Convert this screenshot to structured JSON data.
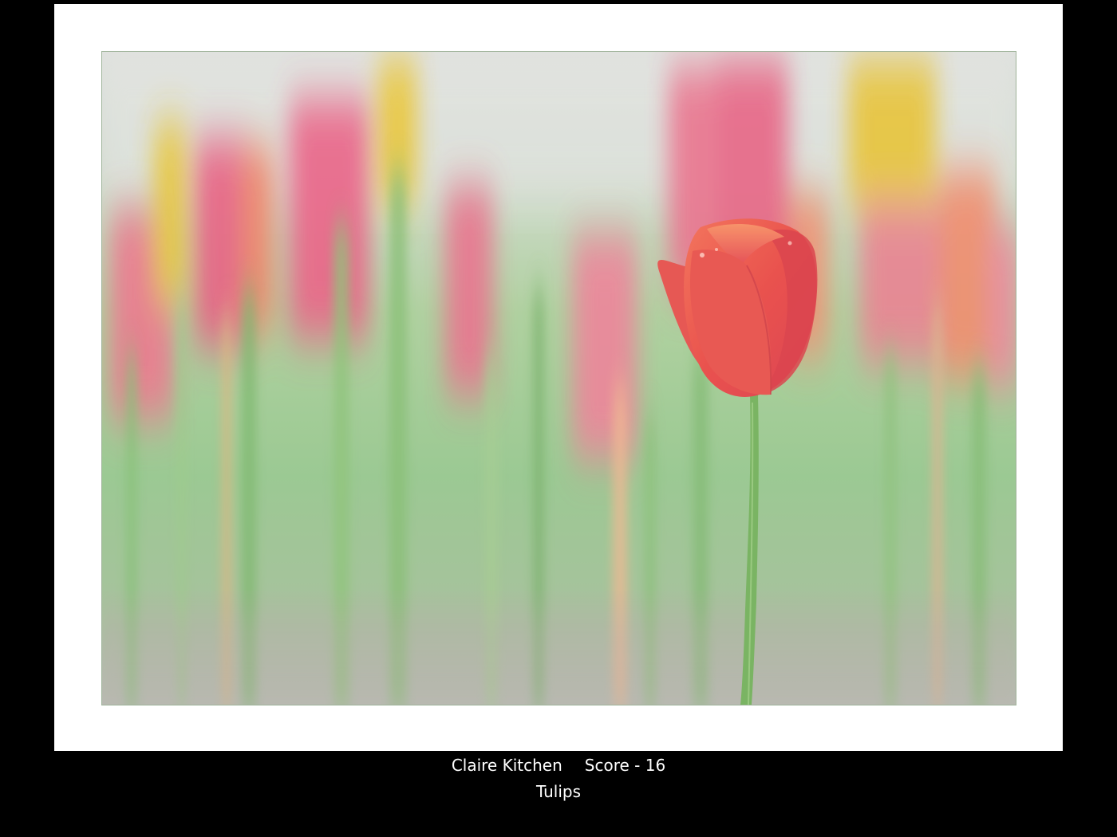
{
  "photo": {
    "author": "Claire Kitchen",
    "score_text": "Score - 16",
    "title": "Tulips"
  },
  "colors": {
    "background": "#000000",
    "mount": "#ffffff",
    "tulip": "#e84a3f",
    "stem": "#6fae56",
    "blur_pink": "#e8607a",
    "blur_yellow": "#e6c62a",
    "blur_green": "#8fc47e"
  }
}
